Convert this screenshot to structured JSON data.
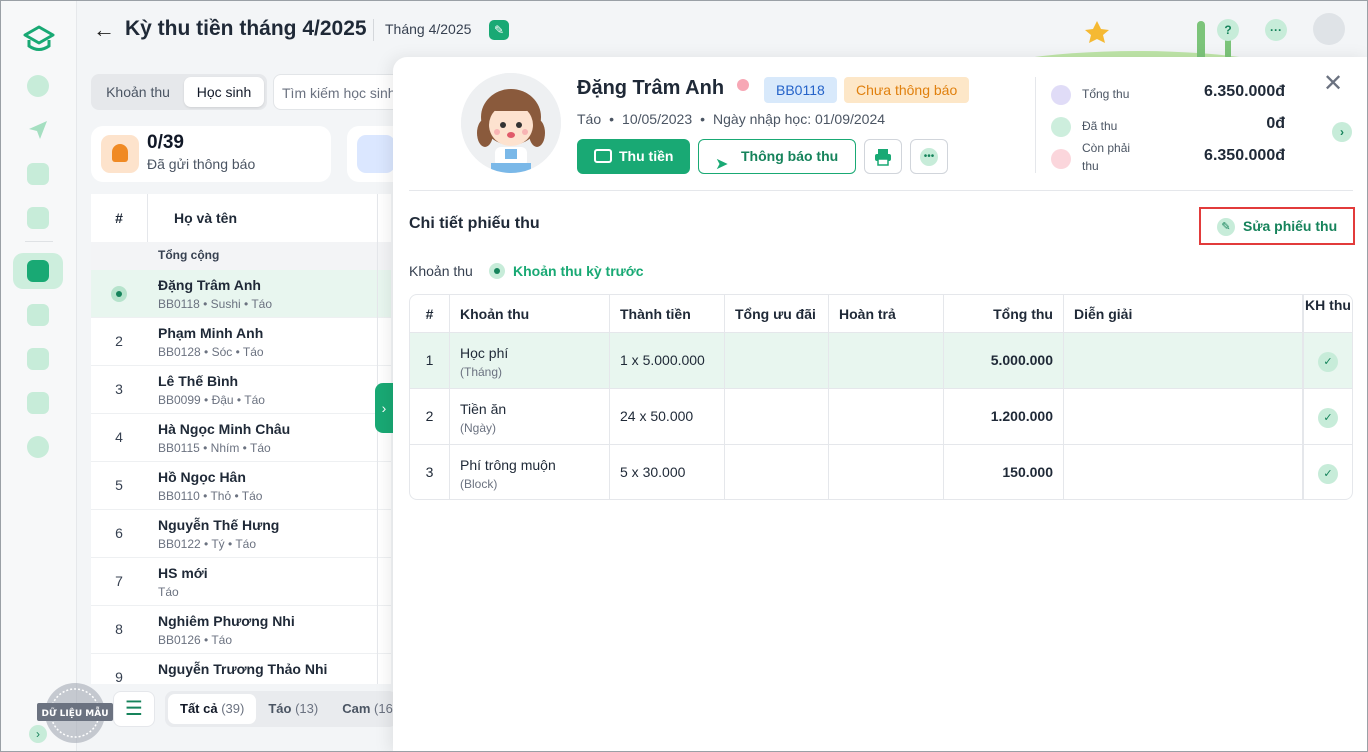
{
  "header": {
    "title": "Kỳ thu tiền tháng 4/2025",
    "subtitle": "Tháng 4/2025"
  },
  "list_panel": {
    "tabs": [
      "Khoản thu",
      "Học sinh"
    ],
    "active_tab": "Học sinh",
    "search_placeholder": "Tìm kiếm học sinh",
    "stat": {
      "value": "0/39",
      "label": "Đã gửi thông báo"
    },
    "columns": {
      "num": "#",
      "name": "Họ và tên"
    },
    "total_label": "Tổng cộng",
    "rows": [
      {
        "num": "",
        "name": "Đặng Trâm Anh",
        "meta": "BB0118 • Sushi • Táo",
        "selected": true
      },
      {
        "num": "2",
        "name": "Phạm Minh Anh",
        "meta": "BB0128 • Sóc • Táo"
      },
      {
        "num": "3",
        "name": "Lê Thế Bình",
        "meta": "BB0099 • Đậu • Táo"
      },
      {
        "num": "4",
        "name": "Hà Ngọc Minh Châu",
        "meta": "BB0115 • Nhím • Táo"
      },
      {
        "num": "5",
        "name": "Hồ Ngọc Hân",
        "meta": "BB0110 • Thỏ • Táo"
      },
      {
        "num": "6",
        "name": "Nguyễn Thế Hưng",
        "meta": "BB0122 • Tý • Táo"
      },
      {
        "num": "7",
        "name": "HS mới",
        "meta": "Táo"
      },
      {
        "num": "8",
        "name": "Nghiêm Phương Nhi",
        "meta": "BB0126 • Táo"
      },
      {
        "num": "9",
        "name": "Nguyễn Trương Thảo Nhi",
        "meta": ""
      }
    ],
    "filter_tabs": [
      {
        "label": "Tất cả",
        "count": "(39)"
      },
      {
        "label": "Táo",
        "count": "(13)"
      },
      {
        "label": "Cam",
        "count": "(16"
      }
    ],
    "stamp_text": "DỮ LIỆU MẪU"
  },
  "student": {
    "name": "Đặng Trâm Anh",
    "code": "BB0118",
    "status": "Chưa thông báo",
    "class": "Táo",
    "dob": "10/05/2023",
    "enroll": "Ngày nhập học: 01/09/2024",
    "btn_collect": "Thu tiền",
    "btn_notify": "Thông báo thu"
  },
  "summary": [
    {
      "label": "Tổng thu",
      "value": "6.350.000đ"
    },
    {
      "label": "Đã thu",
      "value": "0đ"
    },
    {
      "label": "Còn phải thu",
      "value": "6.350.000đ"
    }
  ],
  "detail": {
    "title": "Chi tiết phiếu thu",
    "edit_label": "Sửa phiếu thu",
    "khoan_thu_label": "Khoản thu",
    "prev_link": "Khoản thu kỳ trước",
    "columns": [
      "#",
      "Khoản thu",
      "Thành tiền",
      "Tổng ưu đãi",
      "Hoàn trả",
      "Tổng thu",
      "Diễn giải",
      "KH thu"
    ],
    "rows": [
      {
        "num": "1",
        "name": "Học phí",
        "unit": "(Tháng)",
        "amount": "1 x 5.000.000",
        "discount": "",
        "refund": "",
        "total": "5.000.000",
        "note": ""
      },
      {
        "num": "2",
        "name": "Tiền ăn",
        "unit": "(Ngày)",
        "amount": "24 x 50.000",
        "discount": "",
        "refund": "",
        "total": "1.200.000",
        "note": ""
      },
      {
        "num": "3",
        "name": "Phí trông muộn",
        "unit": "(Block)",
        "amount": "5 x 30.000",
        "discount": "",
        "refund": "",
        "total": "150.000",
        "note": ""
      }
    ]
  },
  "colors": {
    "accent": "#19a974",
    "highlight": "#e23b3b",
    "status": "#e0800e"
  }
}
